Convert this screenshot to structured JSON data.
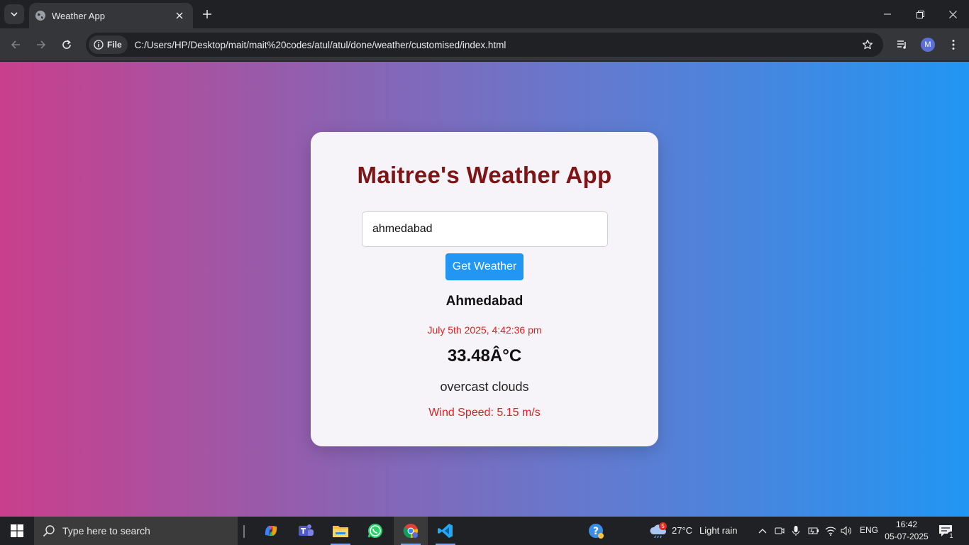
{
  "browser": {
    "tab_title": "Weather App",
    "chip_label": "File",
    "url": "C:/Users/HP/Desktop/mait/mait%20codes/atul/atul/done/weather/customised/index.html",
    "profile_initial": "M"
  },
  "app": {
    "title": "Maitree's Weather App",
    "search_value": "ahmedabad",
    "button_label": "Get Weather",
    "city": "Ahmedabad",
    "datetime": "July 5th 2025, 4:42:36 pm",
    "temperature": "33.48Â°C",
    "description": "overcast clouds",
    "wind": "Wind Speed: 5.15 m/s"
  },
  "colors": {
    "title": "#7e1416",
    "accent": "#2196f3",
    "highlight_text": "#e0201e",
    "gradient_start": "#c93f8c",
    "gradient_end": "#2196f3"
  },
  "taskbar": {
    "search_placeholder": "Type here to search",
    "weather_badge": "5",
    "weather_temp": "27°C",
    "weather_desc": "Light rain",
    "language": "ENG",
    "time": "16:42",
    "date": "05-07-2025",
    "notification_count": "1"
  }
}
